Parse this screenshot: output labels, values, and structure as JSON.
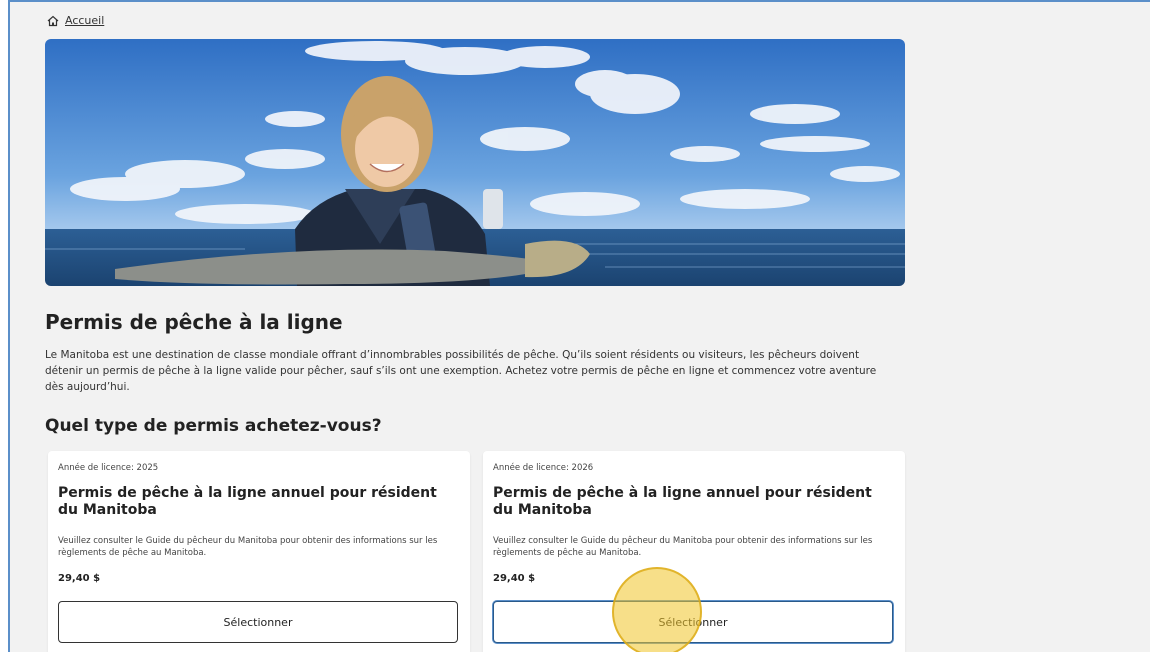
{
  "breadcrumb": {
    "home_label": "Accueil"
  },
  "page": {
    "title": "Permis de pêche à la ligne",
    "intro": "Le Manitoba est une destination de classe mondiale offrant d’innombrables possibilités de pêche. Qu’ils soient résidents ou visiteurs, les pêcheurs doivent détenir un permis de pêche à la ligne valide pour pêcher, sauf s’ils ont une exemption. Achetez votre permis de pêche en ligne et commencez votre aventure dès aujourd’hui.",
    "question": "Quel type de permis achetez-vous?"
  },
  "cards": [
    {
      "year_label": "Année de licence: 2025",
      "title": "Permis de pêche à la ligne annuel pour résident du Manitoba",
      "description": "Veuillez consulter le Guide du pêcheur du Manitoba pour obtenir des informations sur les règlements de pêche au Manitoba.",
      "price": "29,40 $",
      "button_label": "Sélectionner"
    },
    {
      "year_label": "Année de licence: 2026",
      "title": "Permis de pêche à la ligne annuel pour résident du Manitoba",
      "description": "Veuillez consulter le Guide du pêcheur du Manitoba pour obtenir des informations sur les règlements de pêche au Manitoba.",
      "price": "29,40 $",
      "button_label": "Sélectionner"
    }
  ],
  "colors": {
    "frame_border": "#5b8fc9",
    "page_background": "#f2f2f2",
    "cursor_highlight": "#f0c428"
  },
  "icons": {
    "home": "home-icon"
  }
}
